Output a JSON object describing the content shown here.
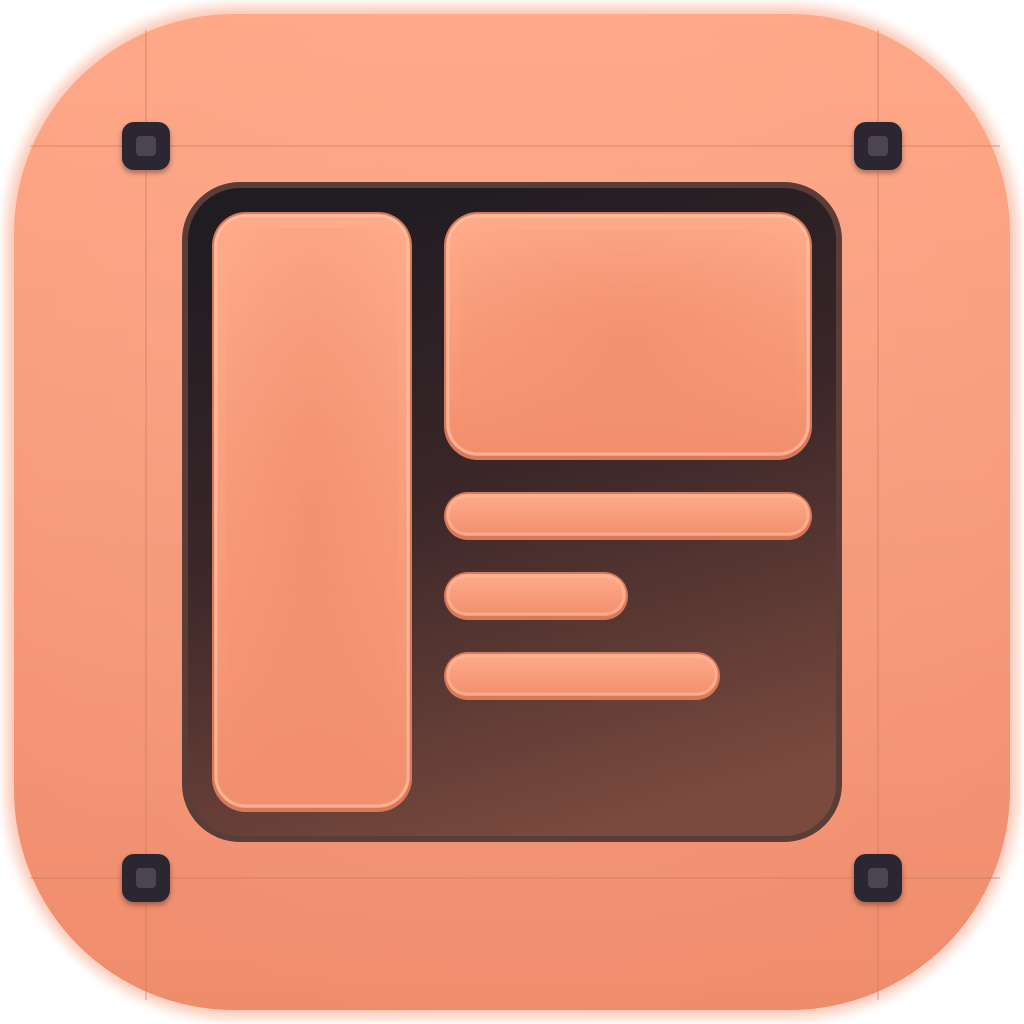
{
  "icon": {
    "name": "layout-template-icon",
    "colors": {
      "tile_light": "#FFA888",
      "tile": "#F79C7C",
      "tile_dark": "#EF8C6C",
      "guide_line": "#C97A62",
      "screen_top": "#1F1C22",
      "screen_mid": "#3A2628",
      "screen_bottom": "#7A4A3E",
      "screen_border": "#6E4A44",
      "block_fill": "#F5916E",
      "block_highlight": "#FFB596",
      "block_edge": "#D9785A",
      "rivet": "#2A2730",
      "rivet_highlight": "#4A4650"
    },
    "content_lines": [
      {
        "length_fraction": 1.0
      },
      {
        "length_fraction": 0.5
      },
      {
        "length_fraction": 0.75
      }
    ]
  }
}
